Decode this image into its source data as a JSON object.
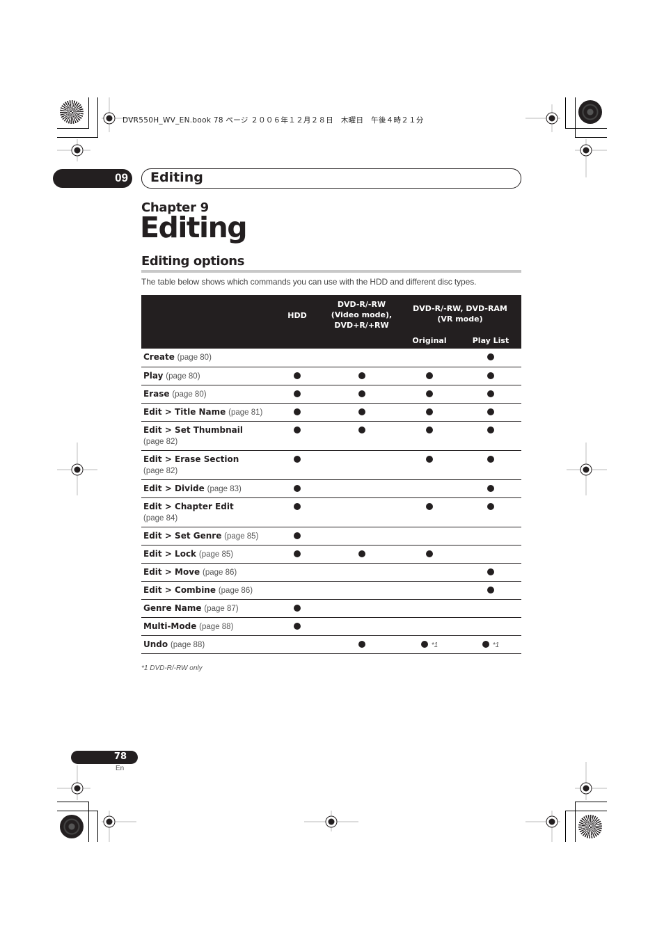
{
  "print_header": "DVR550H_WV_EN.book  78 ページ  ２００６年１２月２８日　木曜日　午後４時２１分",
  "chapter_tab": {
    "number": "09",
    "title": "Editing"
  },
  "chapter_label": "Chapter 9",
  "page_title": "Editing",
  "section": {
    "title": "Editing options",
    "intro": "The table below shows which commands you can use with the HDD and different disc types."
  },
  "table": {
    "headers": {
      "hdd": "HDD",
      "video_mode_line1": "DVD-R/-RW",
      "video_mode_line2": "(Video mode),",
      "video_mode_line3": "DVD+R/+RW",
      "vr_mode_line1": "DVD-R/-RW, DVD-RAM",
      "vr_mode_line2": "(VR mode)",
      "original": "Original",
      "play_list": "Play List"
    },
    "rows": [
      {
        "command": "Create",
        "page": "(page 80)",
        "hdd": false,
        "video": false,
        "original": false,
        "playlist": true
      },
      {
        "command": "Play",
        "page": "(page 80)",
        "hdd": true,
        "video": true,
        "original": true,
        "playlist": true
      },
      {
        "command": "Erase",
        "page": "(page 80)",
        "hdd": true,
        "video": true,
        "original": true,
        "playlist": true
      },
      {
        "command": "Edit > Title Name",
        "page": "(page 81)",
        "hdd": true,
        "video": true,
        "original": true,
        "playlist": true
      },
      {
        "command": "Edit > Set Thumbnail",
        "page": "(page 82)",
        "hdd": true,
        "video": true,
        "original": true,
        "playlist": true
      },
      {
        "command": "Edit > Erase Section",
        "page": "(page 82)",
        "hdd": true,
        "video": false,
        "original": true,
        "playlist": true
      },
      {
        "command": "Edit > Divide",
        "page": "(page 83)",
        "hdd": true,
        "video": false,
        "original": false,
        "playlist": true
      },
      {
        "command": "Edit > Chapter Edit",
        "page": "(page 84)",
        "hdd": true,
        "video": false,
        "original": true,
        "playlist": true
      },
      {
        "command": "Edit > Set Genre",
        "page": "(page 85)",
        "hdd": true,
        "video": false,
        "original": false,
        "playlist": false
      },
      {
        "command": "Edit > Lock",
        "page": "(page 85)",
        "hdd": true,
        "video": true,
        "original": true,
        "playlist": false
      },
      {
        "command": "Edit > Move",
        "page": "(page 86)",
        "hdd": false,
        "video": false,
        "original": false,
        "playlist": true
      },
      {
        "command": "Edit > Combine",
        "page": "(page 86)",
        "hdd": false,
        "video": false,
        "original": false,
        "playlist": true
      },
      {
        "command": "Genre Name",
        "page": "(page 87)",
        "hdd": true,
        "video": false,
        "original": false,
        "playlist": false
      },
      {
        "command": "Multi-Mode",
        "page": "(page 88)",
        "hdd": true,
        "video": false,
        "original": false,
        "playlist": false
      },
      {
        "command": "Undo",
        "page": "(page 88)",
        "hdd": false,
        "video": true,
        "original": true,
        "playlist": true,
        "original_note": "*1",
        "playlist_note": "*1"
      }
    ],
    "wrapped_rows": [
      4,
      5,
      7
    ]
  },
  "footnote": "*1 DVD-R/-RW only",
  "page_number": "78",
  "language": "En",
  "colors": {
    "ink": "#231f20",
    "rule_gray": "#c8c8c8"
  }
}
